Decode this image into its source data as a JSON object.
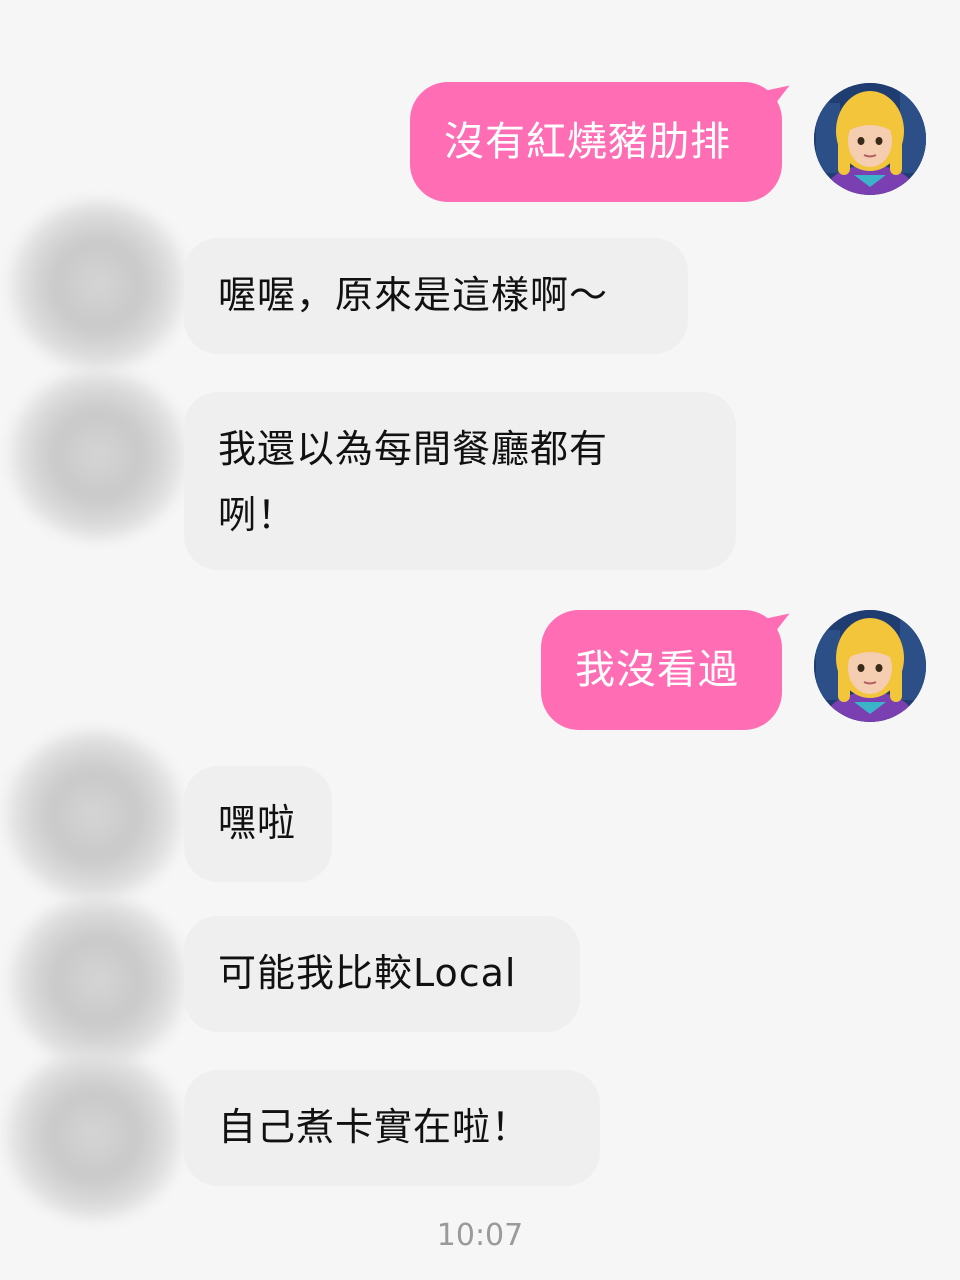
{
  "messages": [
    {
      "side": "out",
      "text": "沒有紅燒豬肋排"
    },
    {
      "side": "in",
      "text": "喔喔，原來是這樣啊～"
    },
    {
      "side": "in",
      "line1": "我還以為每間餐廳都有",
      "line2": "咧！"
    },
    {
      "side": "out",
      "text": "我沒看過"
    },
    {
      "side": "in",
      "text": "嘿啦"
    },
    {
      "side": "in",
      "text": "可能我比較Local"
    },
    {
      "side": "in",
      "text": "自己煮卡實在啦！"
    }
  ],
  "timestamp": "10:07",
  "colors": {
    "outgoing_bubble": "#ff6eb4",
    "incoming_bubble": "#efefef",
    "background": "#f6f6f6"
  },
  "icons": {
    "my_avatar": "cartoon-girl-avatar",
    "other_avatar": "blurred-avatar"
  }
}
